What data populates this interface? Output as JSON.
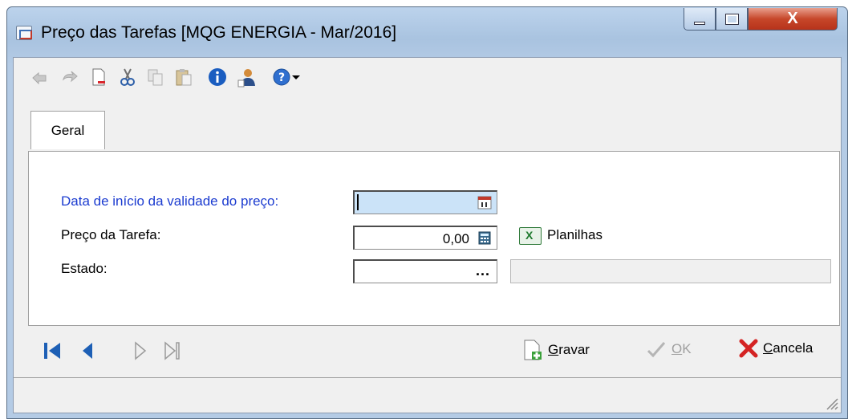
{
  "window": {
    "title": "Preço das Tarefas [MQG ENERGIA - Mar/2016]",
    "close_glyph": "X"
  },
  "toolbar": {
    "icons": [
      "undo-icon",
      "redo-icon",
      "new-document-icon",
      "cut-icon",
      "copy-icon",
      "paste-icon",
      "info-icon",
      "user-icon",
      "help-icon",
      "dropdown-arrow-icon"
    ]
  },
  "tabs": [
    {
      "label": "Geral",
      "selected": true
    }
  ],
  "form": {
    "start_date": {
      "label": "Data de início da validade do preço:",
      "value": ""
    },
    "price": {
      "label": "Preço da Tarefa:",
      "value": "0,00"
    },
    "spreadsheets": {
      "label": "Planilhas"
    },
    "state": {
      "label": "Estado:",
      "value": "",
      "ellipsis": "...",
      "description": ""
    }
  },
  "actions": {
    "save": {
      "prefix": "",
      "underline": "G",
      "rest": "ravar"
    },
    "ok": {
      "underline": "O",
      "rest": "K",
      "enabled": false
    },
    "cancel": {
      "underline": "C",
      "rest": "ancela"
    }
  },
  "colors": {
    "active_field": "#cbe3f8",
    "label_blue": "#1c3cd0",
    "nav_blue": "#1d5fb5",
    "cancel_red": "#d42323"
  }
}
